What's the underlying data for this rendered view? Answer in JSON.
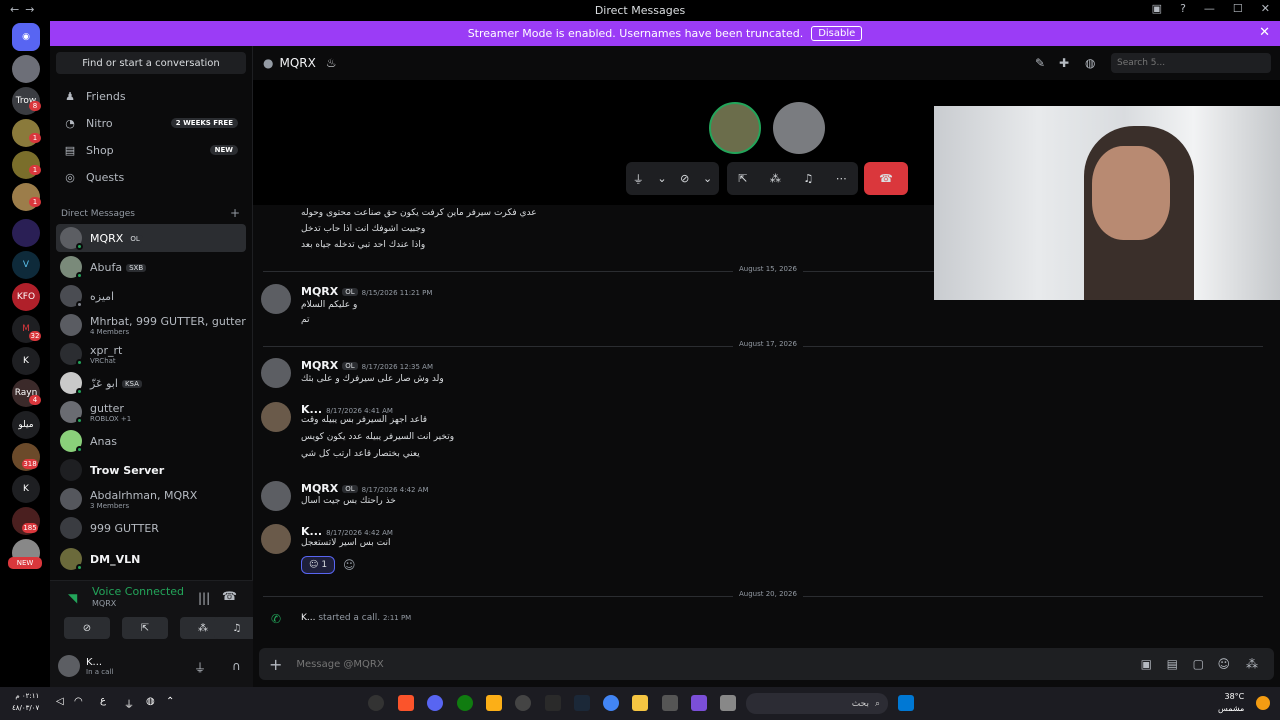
{
  "window": {
    "title": "Direct Messages"
  },
  "banner": {
    "text": "Streamer Mode is enabled. Usernames have been truncated.",
    "button": "Disable"
  },
  "servers": {
    "badges": [
      "8",
      "1",
      "1",
      "1",
      "1",
      "4",
      "318",
      "185",
      "32"
    ],
    "labels": [
      "Trow",
      "K",
      "K",
      "ميلو"
    ],
    "new_label": "NEW"
  },
  "sidebar": {
    "search_label": "Find or start a conversation",
    "nav": [
      {
        "label": "Friends",
        "pill": ""
      },
      {
        "label": "Nitro",
        "pill": "2 WEEKS FREE"
      },
      {
        "label": "Shop",
        "pill": "NEW"
      },
      {
        "label": "Quests",
        "pill": ""
      }
    ],
    "dm_header": "Direct Messages",
    "dms": [
      {
        "name": "MQRX",
        "tag": "OL",
        "sub": ""
      },
      {
        "name": "Abufa",
        "tag": "SXB",
        "sub": ""
      },
      {
        "name": "اميزه",
        "tag": "",
        "sub": ""
      },
      {
        "name": "Mhrbat, 999 GUTTER, gutter",
        "tag": "",
        "sub": "4 Members"
      },
      {
        "name": "xpr_rt",
        "tag": "",
        "sub": "VRChat"
      },
      {
        "name": "ابو عَزّ",
        "tag": "KSA",
        "sub": ""
      },
      {
        "name": "gutter",
        "tag": "",
        "sub": "ROBLOX +1"
      },
      {
        "name": "Anas",
        "tag": "",
        "sub": ""
      },
      {
        "name": "Trow Server",
        "tag": "",
        "sub": ""
      },
      {
        "name": "Abdalrhman, MQRX",
        "tag": "",
        "sub": "3 Members"
      },
      {
        "name": "999 GUTTER",
        "tag": "",
        "sub": ""
      },
      {
        "name": "DM_VLN",
        "tag": "",
        "sub": ""
      }
    ]
  },
  "voice": {
    "title": "Voice Connected",
    "channel": "MQRX"
  },
  "user": {
    "name": "K...",
    "status": "In a call"
  },
  "channel": {
    "name": "MQRX",
    "search_placeholder": "Search 5..."
  },
  "messages": {
    "top_lines": [
      "عدي فكرت سيرفر ماين كرفت يكون حق صناعت محتوى وحوله",
      "وجبيت اشوفك انت اذا حاب تدخل",
      "واذا عندك احد تبي تدخله جياه بعد"
    ],
    "groups": [
      {
        "date": "August 15, 2026",
        "author": "MQRX",
        "tag": "OL",
        "time": "8/15/2026 11:21 PM",
        "lines": [
          "و عليكم السلام",
          "تم"
        ]
      },
      {
        "date": "August 17, 2026",
        "author": "MQRX",
        "tag": "OL",
        "time": "8/17/2026 12:35 AM",
        "lines": [
          "ولد وش صار على سيرفرك و على بثك"
        ]
      },
      {
        "date": "",
        "author": "K...",
        "tag": "",
        "time": "8/17/2026 4:41 AM",
        "lines": [
          "قاعد اجهز السيرفر بس يبيله وقت",
          "وتخير انت السيرفر يبيله عدد يكون كويس",
          "يعني بختصار قاعد ارتب كل شي"
        ]
      },
      {
        "date": "",
        "author": "MQRX",
        "tag": "OL",
        "time": "8/17/2026 4:42 AM",
        "lines": [
          "خذ راحتك بس جيت اسال"
        ]
      },
      {
        "date": "",
        "author": "K...",
        "tag": "",
        "time": "8/17/2026 4:42 AM",
        "lines": [
          "انت بس اسير لاتستعجل"
        ]
      }
    ],
    "reaction_count": "1",
    "call": {
      "date": "August 20, 2026",
      "author": "K...",
      "text": "started a call.",
      "time": "2:11 PM"
    }
  },
  "composer": {
    "placeholder": "Message @MQRX"
  },
  "taskbar": {
    "time": "٠٢:١١ م",
    "date": "٤٨/٠٣/٠٧",
    "lang": "ع",
    "search_text": "بحث",
    "weather_temp": "38°C",
    "weather_text": "مشمس"
  }
}
